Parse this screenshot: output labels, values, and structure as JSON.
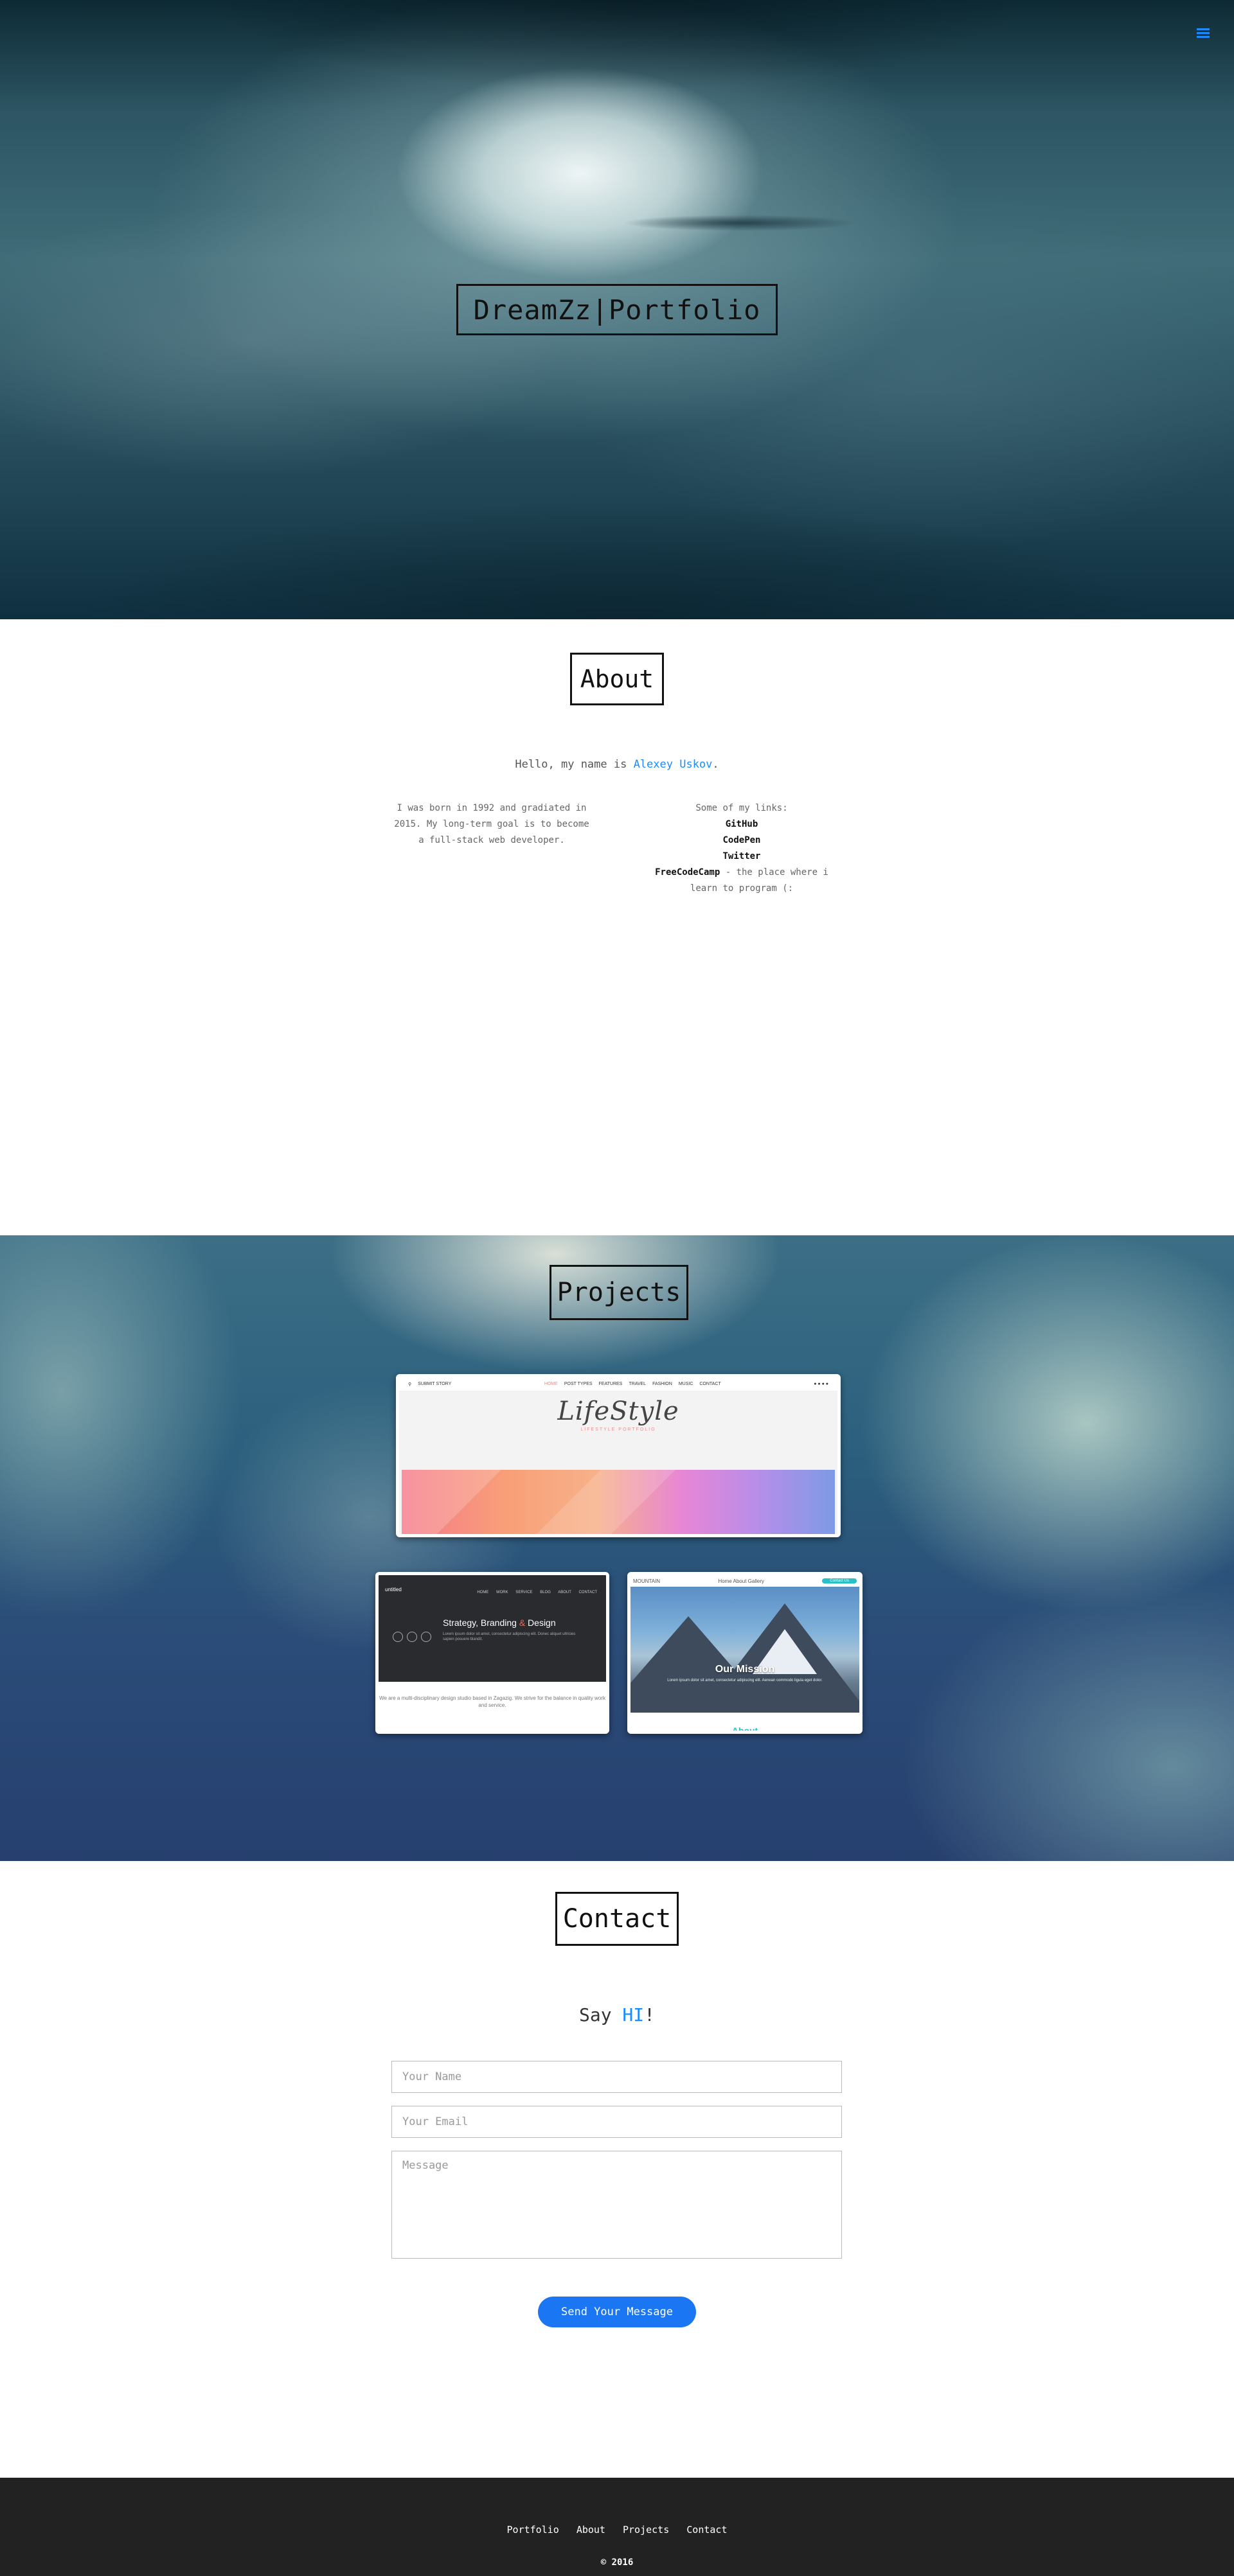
{
  "hero": {
    "title": "DreamZz|Portfolio",
    "menu_icon": "hamburger-icon",
    "accent": "#1a8cff"
  },
  "about": {
    "title": "About",
    "intro_prefix": "Hello, my name is ",
    "intro_name": "Alexey Uskov",
    "intro_suffix": ".",
    "bio": "I was born in 1992 and gradiated in 2015. My long-term goal is to become a full-stack web developer.",
    "links_heading": "Some of my links:",
    "links": [
      "GitHub",
      "CodePen",
      "Twitter",
      "FreeCodeCamp"
    ],
    "fcc_note": " - the place where i learn to program (:"
  },
  "projects": {
    "title": "Projects",
    "lifestyle": {
      "nav": [
        "SUBMIT STORY",
        "HOME",
        "POST TYPES",
        "FEATURES",
        "TRAVEL",
        "FASHION",
        "MUSIC",
        "CONTACT"
      ],
      "logo": "LifeStyle",
      "tagline": "LIFESTYLE PORTFOLIO"
    },
    "untitled": {
      "brand": "untitled",
      "menu": "HOME WORK SERVICE BLOG ABOUT CONTACT",
      "heading_a": "Strategy, Branding ",
      "heading_amp": "&",
      "heading_b": " Design",
      "text": "Lorem ipsum dolor sit amet, consectetur adipiscing elit. Donec aliquet ultricies sapien posuere blandit.",
      "footer": "We are a multi-disciplinary design studio based in Zagazig. We strive for the balance in quality work and service."
    },
    "mountain": {
      "brand": "MOUNTAIN",
      "menu": "Home About Gallery",
      "button": "Contact Us",
      "mission": "Our Mission",
      "text": "Lorem ipsum dolor sit amet, consectetur adipiscing elit. Aenean commodo ligula eget dolor.",
      "about": "About"
    }
  },
  "contact": {
    "title": "Contact",
    "say": "Say ",
    "hi": "HI",
    "bang": "!",
    "name_placeholder": "Your Name",
    "email_placeholder": "Your Email",
    "message_placeholder": "Message",
    "send_label": "Send Your Message",
    "button_color": "#1a76f2"
  },
  "footer": {
    "nav": [
      "Portfolio",
      "About",
      "Projects",
      "Contact"
    ],
    "copyright": "© 2016"
  }
}
